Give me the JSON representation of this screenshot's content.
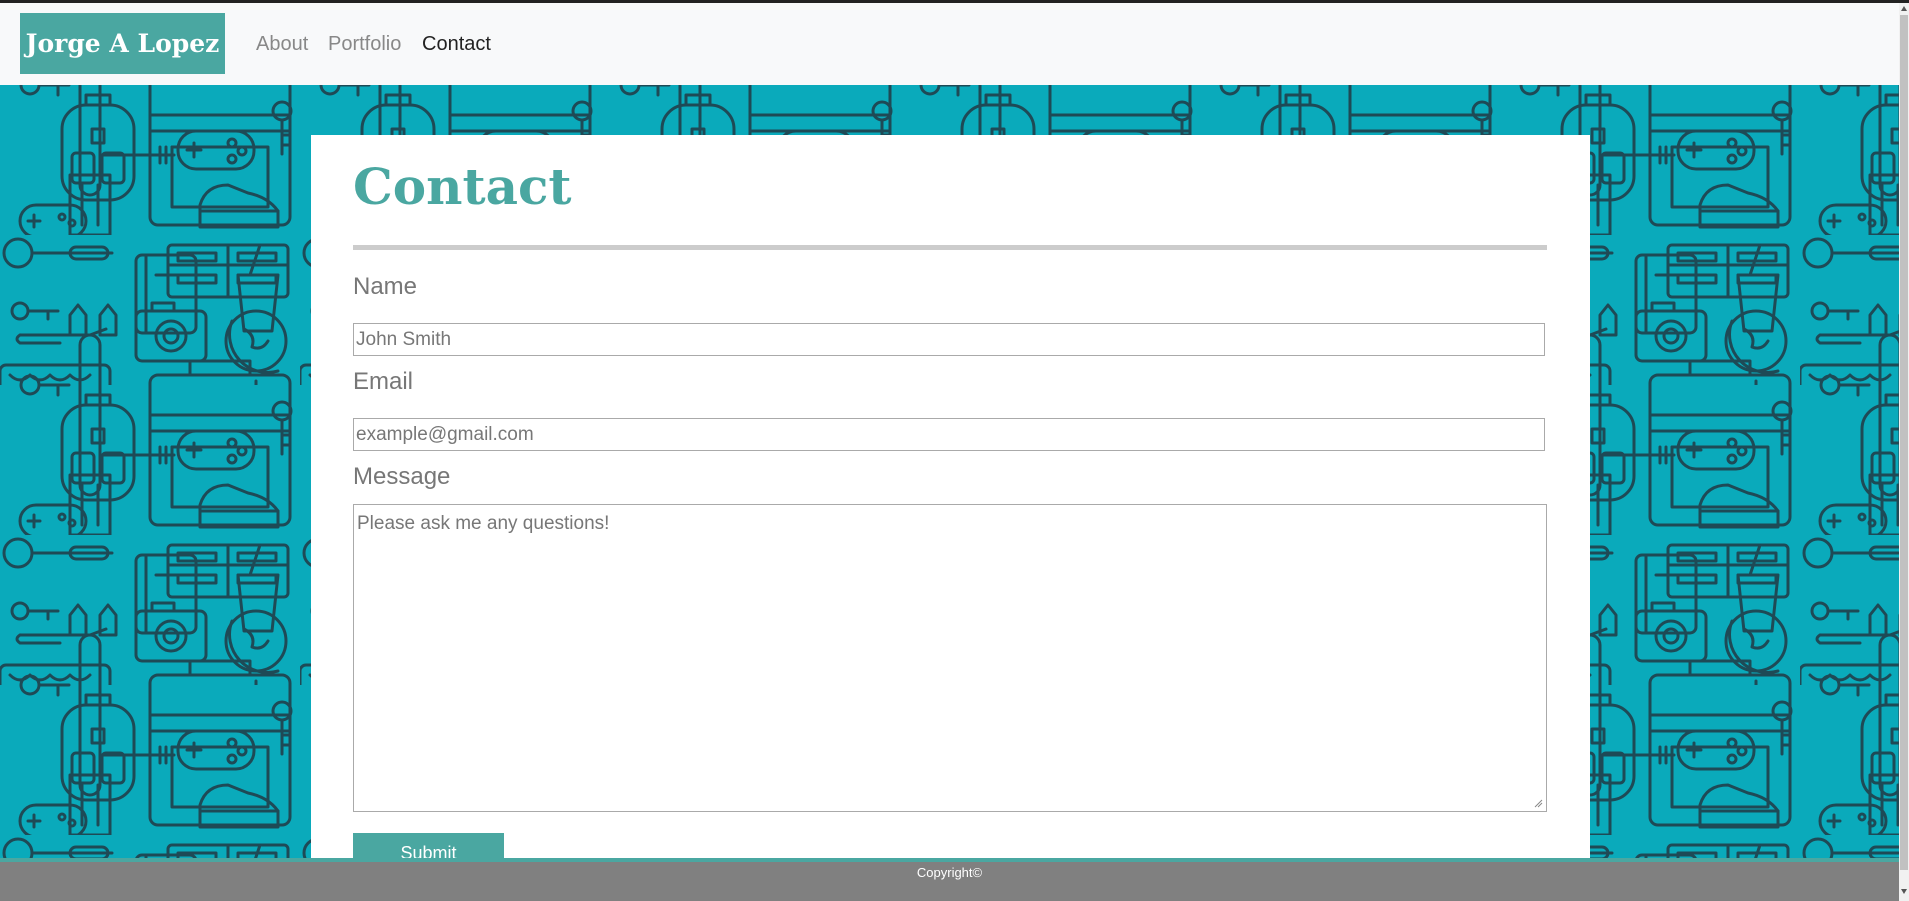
{
  "navbar": {
    "brand": "Jorge A Lopez",
    "links": [
      {
        "label": "About"
      },
      {
        "label": "Portfolio"
      },
      {
        "label": "Contact"
      }
    ]
  },
  "contact": {
    "title": "Contact",
    "name_label": "Name",
    "name_placeholder": "John Smith",
    "email_label": "Email",
    "email_placeholder": "example@gmail.com",
    "message_label": "Message",
    "message_placeholder": "Please ask me any questions!",
    "submit_label": "Submit"
  },
  "footer": {
    "copyright": "Copyright©"
  },
  "colors": {
    "accent": "#4aa7a1",
    "pattern_background": "#0aaabb",
    "pattern_stroke": "#1e4a56",
    "footer": "#808080"
  }
}
